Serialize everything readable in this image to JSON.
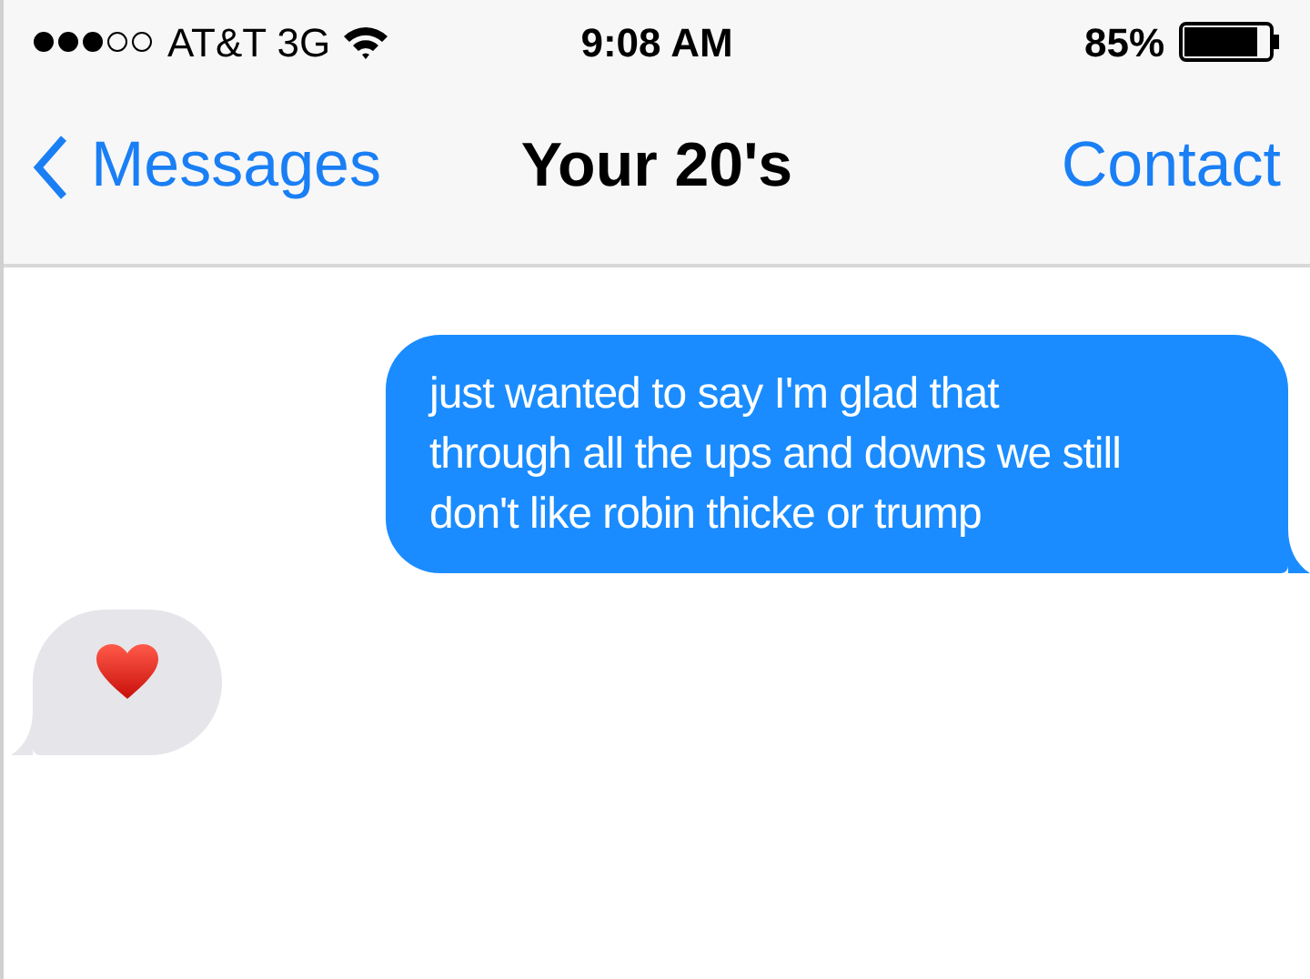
{
  "status_bar": {
    "carrier": "AT&T 3G",
    "time": "9:08 AM",
    "battery": "85%"
  },
  "nav": {
    "back": "Messages",
    "title": "Your 20's",
    "action": "Contact"
  },
  "messages": [
    {
      "kind": "outgoing",
      "text": "just wanted to say I'm glad that through all the ups and downs we still don't like robin thicke or trump"
    },
    {
      "kind": "incoming"
    }
  ]
}
